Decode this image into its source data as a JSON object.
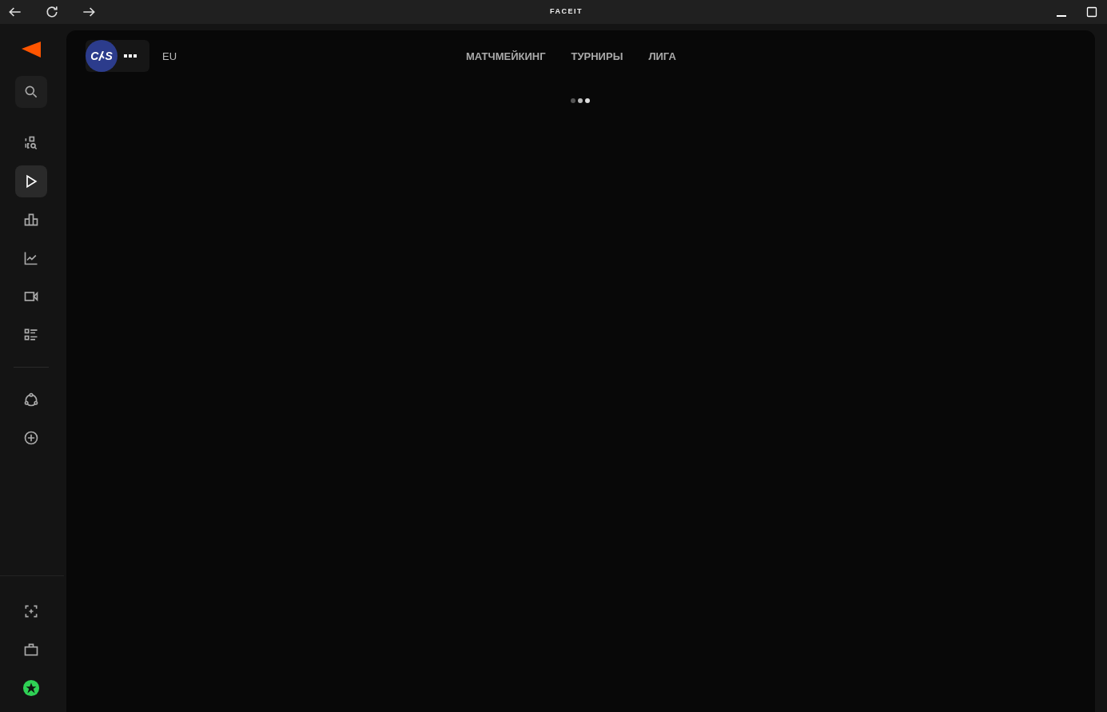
{
  "window": {
    "title": "FACEIT"
  },
  "sidebar": {
    "search": {
      "kind": "search"
    },
    "items": [
      {
        "kind": "finder",
        "selected": false
      },
      {
        "kind": "play",
        "selected": true
      },
      {
        "kind": "ranking",
        "selected": false
      },
      {
        "kind": "stats",
        "selected": false
      },
      {
        "kind": "video",
        "selected": false
      },
      {
        "kind": "list",
        "selected": false
      }
    ],
    "extra": [
      {
        "kind": "network"
      },
      {
        "kind": "add"
      }
    ],
    "bottom": [
      {
        "kind": "focus"
      },
      {
        "kind": "case"
      },
      {
        "kind": "star"
      }
    ]
  },
  "header": {
    "game_badge": {
      "left": "C",
      "right": "S"
    },
    "region": "EU",
    "nav": [
      {
        "label": "МАТЧМЕЙКИНГ"
      },
      {
        "label": "ТУРНИРЫ"
      },
      {
        "label": "ЛИГА"
      }
    ]
  }
}
